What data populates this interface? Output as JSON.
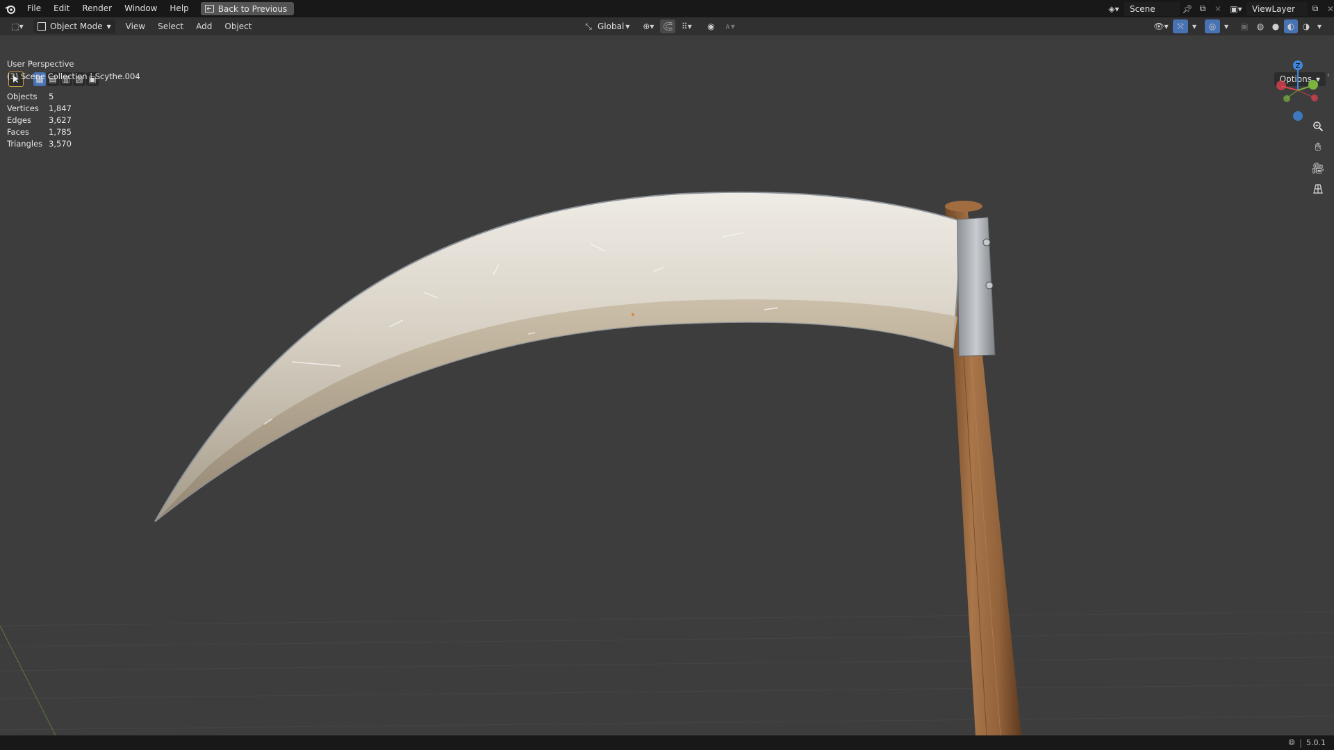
{
  "topbar": {
    "menus": [
      "File",
      "Edit",
      "Render",
      "Window",
      "Help"
    ],
    "back_button": "Back to Previous",
    "scene_name": "Scene",
    "view_layer": "ViewLayer"
  },
  "header": {
    "mode": "Object Mode",
    "menus": [
      "View",
      "Select",
      "Add",
      "Object"
    ],
    "transform_orientation": "Global"
  },
  "viewport": {
    "perspective_label": "User Perspective",
    "collection_label": "(3) Scene Collection | Scythe.004",
    "options_label": "Options",
    "stats": [
      {
        "label": "Objects",
        "value": "5"
      },
      {
        "label": "Vertices",
        "value": "1,847"
      },
      {
        "label": "Edges",
        "value": "3,627"
      },
      {
        "label": "Faces",
        "value": "1,785"
      },
      {
        "label": "Triangles",
        "value": "3,570"
      }
    ],
    "gizmo": {
      "z_label": "Z"
    }
  },
  "statusbar": {
    "version": "5.0.1"
  },
  "colors": {
    "bg": "#3d3d3d",
    "topbar": "#181818",
    "header": "#303030",
    "active_blue": "#4772b3",
    "axis_x": "#e0424f",
    "axis_y": "#7ab33e",
    "axis_z": "#3f87e0"
  }
}
